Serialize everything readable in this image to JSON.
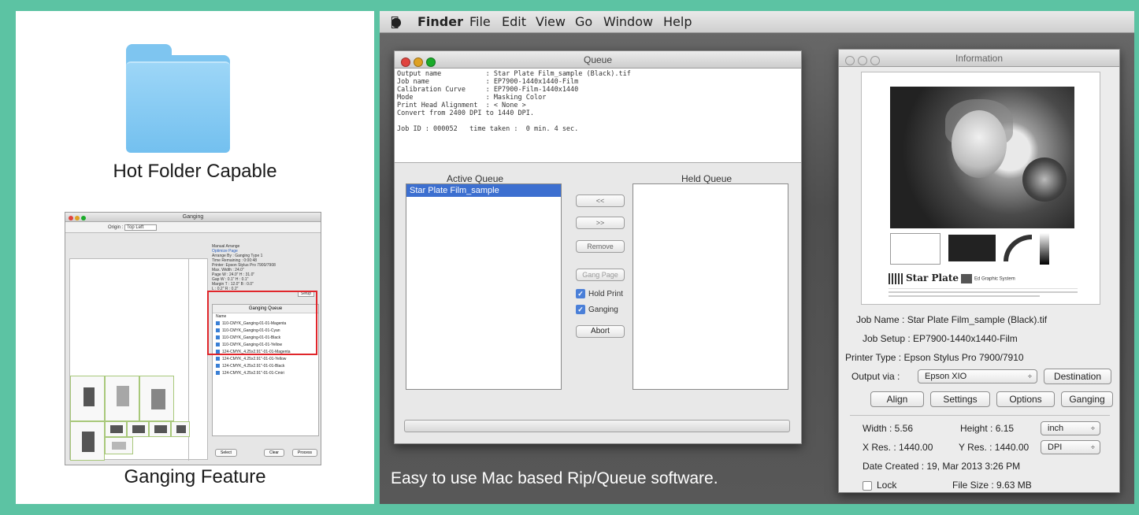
{
  "left": {
    "hot_folder_caption": "Hot Folder Capable",
    "ganging_caption": "Ganging Feature",
    "ganging_window": {
      "title": "Ganging",
      "origin_label": "Origin :",
      "origin_value": "Top Left",
      "manual_arrange": "Manual Arrange",
      "optimize_page": "Optimize Page",
      "arrange_by": "Arrange By :",
      "arrange_value": "Ganging Type 1",
      "time_remaining": "Time Remaining : 0:00:48",
      "printer": "Printer: Epson Stylus Pro 7900/7908",
      "max_width": "Max. Width : 24.0\"",
      "page": "Page W : 24.0\"   H : 31.0\"",
      "gap": "Gap W : 0.1\"   H : 0.1\"",
      "margin": "Margin T : 12.0\"  B : 0.0\"",
      "margin2": "L : 0.2\"   R : 0.2\"",
      "setup": "Setup",
      "queue_title": "Ganging Queue",
      "queue_header": "Name",
      "queue_items": [
        "110-CMYK_Ganging-01-01-Magenta",
        "110-CMYK_Ganging-01-01-Cyan",
        "110-CMYK_Ganging-01-01-Black",
        "110-CMYK_Ganging-01-01-Yellow",
        "124-CMYK_4.25x2.91\"-01-01-Magenta",
        "124-CMYK_4.25x2.91\"-01-01-Yellow",
        "124-CMYK_4.25x2.91\"-01-01-Black",
        "124-CMYK_4.25x2.91\"-01-01-Cmiri"
      ],
      "select": "Select",
      "clear": "Clear",
      "process": "Process"
    }
  },
  "menubar": {
    "app": "Finder",
    "items": [
      "File",
      "Edit",
      "View",
      "Go",
      "Window",
      "Help"
    ]
  },
  "queue_window": {
    "title": "Queue",
    "log": [
      "Output name           : Star Plate Film_sample (Black).tif",
      "Job name              : EP7900-1440x1440-Film",
      "Calibration Curve     : EP7900-Film-1440x1440",
      "Mode                  : Masking Color",
      "Print Head Alignment  : < None >",
      "Convert from 2400 DPI to 1440 DPI.",
      "",
      "Job ID : 000052   time taken :  0 min. 4 sec."
    ],
    "active_label": "Active Queue",
    "held_label": "Held Queue",
    "active_items": [
      "Star Plate Film_sample"
    ],
    "btn_left": "<<",
    "btn_right": ">>",
    "btn_remove": "Remove",
    "btn_gang": "Gang Page",
    "hold_print": "Hold Print",
    "ganging": "Ganging",
    "btn_abort": "Abort"
  },
  "tagline": "Easy to use Mac based Rip/Queue software.",
  "info_window": {
    "title": "Information",
    "preview_logo": "Star Plate",
    "preview_logo2": "Ed Graphic System",
    "job_name": "Job Name : Star Plate Film_sample (Black).tif",
    "job_setup": "Job Setup : EP7900-1440x1440-Film",
    "printer_type": "Printer Type : Epson Stylus Pro 7900/7910",
    "output_via_label": "Output via :",
    "output_via_value": "Epson XIO",
    "destination": "Destination",
    "align": "Align",
    "settings": "Settings",
    "options": "Options",
    "ganging": "Ganging",
    "width": "Width : 5.56",
    "height": "Height : 6.15",
    "unit": "inch",
    "xres": "X Res. : 1440.00",
    "yres": "Y Res. : 1440.00",
    "res_unit": "DPI",
    "date_created": "Date Created : 19, Mar 2013 3:26 PM",
    "lock": "Lock",
    "file_size": "File Size : 9.63 MB"
  }
}
